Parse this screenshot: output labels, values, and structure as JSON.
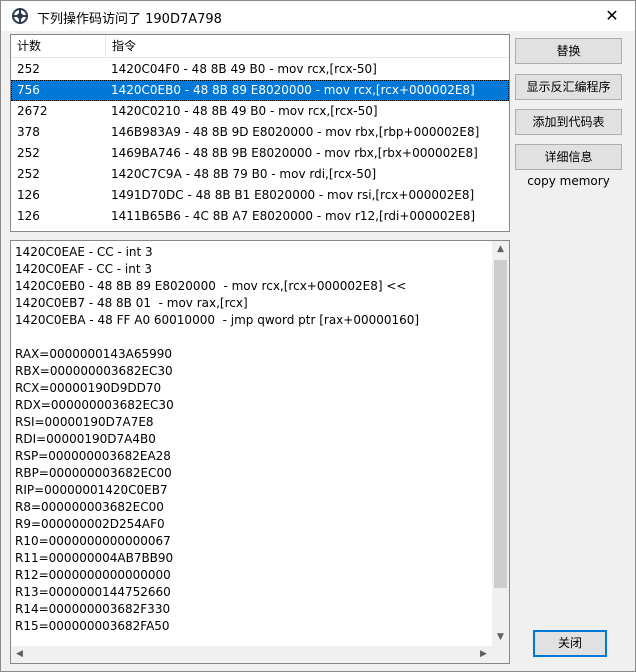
{
  "window": {
    "title": "下列操作码访问了 190D7A798",
    "close_glyph": "✕",
    "icon": "app-icon"
  },
  "list": {
    "columns": [
      "计数",
      "指令"
    ],
    "rows": [
      {
        "count": "252",
        "instruction": "1420C04F0 - 48 8B 49 B0  - mov rcx,[rcx-50]"
      },
      {
        "count": "756",
        "instruction": "1420C0EB0 - 48 8B 89 E8020000  - mov rcx,[rcx+000002E8]",
        "selected": true
      },
      {
        "count": "2672",
        "instruction": "1420C0210 - 48 8B 49 B0  - mov rcx,[rcx-50]"
      },
      {
        "count": "378",
        "instruction": "146B983A9 - 48 8B 9D E8020000  - mov rbx,[rbp+000002E8]"
      },
      {
        "count": "252",
        "instruction": "1469BA746 - 48 8B 9B E8020000  - mov rbx,[rbx+000002E8]"
      },
      {
        "count": "252",
        "instruction": "1420C7C9A - 48 8B 79 B0  - mov rdi,[rcx-50]"
      },
      {
        "count": "126",
        "instruction": "1491D70DC - 48 8B B1 E8020000  - mov rsi,[rcx+000002E8]"
      },
      {
        "count": "126",
        "instruction": "1411B65B6 - 4C 8B A7 E8020000  - mov r12,[rdi+000002E8]"
      }
    ]
  },
  "details": {
    "lines": [
      "1420C0EAE - CC - int 3",
      "1420C0EAF - CC - int 3",
      "1420C0EB0 - 48 8B 89 E8020000  - mov rcx,[rcx+000002E8] <<",
      "1420C0EB7 - 48 8B 01  - mov rax,[rcx]",
      "1420C0EBA - 48 FF A0 60010000  - jmp qword ptr [rax+00000160]",
      "",
      "RAX=0000000143A65990",
      "RBX=000000003682EC30",
      "RCX=00000190D9DD70",
      "RDX=000000003682EC30",
      "RSI=00000190D7A7E8",
      "RDI=00000190D7A4B0",
      "RSP=000000003682EA28",
      "RBP=000000003682EC00",
      "RIP=00000001420C0EB7",
      "R8=000000003682EC00",
      "R9=000000002D254AF0",
      "R10=0000000000000067",
      "R11=000000004AB7BB90",
      "R12=0000000000000000",
      "R13=0000000144752660",
      "R14=000000003682F330",
      "R15=000000003682FA50"
    ]
  },
  "buttons": {
    "replace": "替换",
    "disassemble": "显示反汇编程序",
    "add_to_codelist": "添加到代码表",
    "more_info": "详细信息",
    "copy_memory": "copy memory",
    "close": "关闭"
  }
}
